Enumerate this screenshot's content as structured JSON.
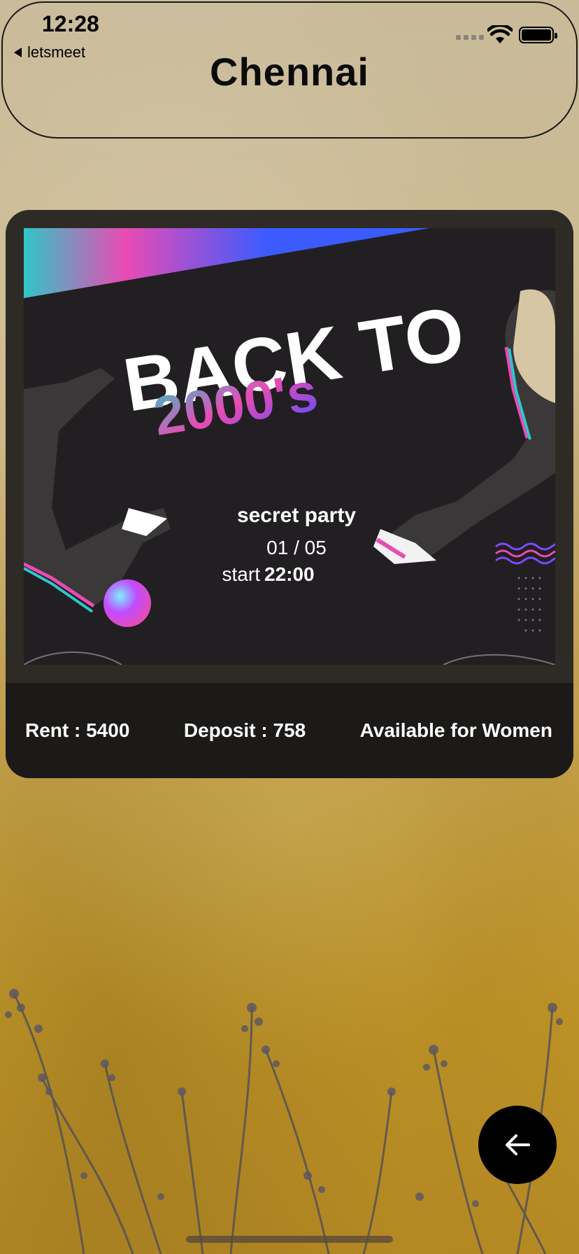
{
  "status_bar": {
    "time": "12:28",
    "back_app_label": "letsmeet"
  },
  "header": {
    "title": "Chennai"
  },
  "listing": {
    "poster": {
      "headline": "BACK TO",
      "year": "2000's",
      "event": "secret party",
      "date": "01 / 05",
      "start_label": "start",
      "start_time": "22:00"
    },
    "rent_text": "Rent : 5400",
    "deposit_text": "Deposit : 758",
    "availability_text": "Available for Women"
  },
  "fab": {
    "icon": "arrow-left-icon"
  },
  "colors": {
    "card_bg": "#2e2a25",
    "info_bar_bg": "#1c1a18",
    "fab_bg": "#000000",
    "poster_bg": "#221f22",
    "accent_pink": "#e94bb4",
    "accent_blue": "#3b5bff",
    "accent_teal": "#2fc6c8"
  }
}
